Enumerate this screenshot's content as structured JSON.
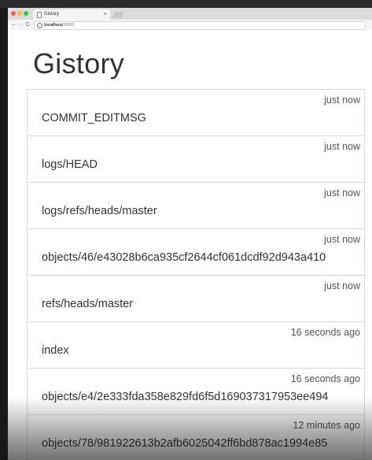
{
  "browser": {
    "tab_title": "Gistory",
    "tab_close": "×",
    "url_host": "localhost",
    "url_port": ":8808",
    "nav_back": "←",
    "nav_forward": "→",
    "nav_reload": "C",
    "info_icon": "i"
  },
  "page": {
    "title": "Gistory"
  },
  "files": [
    {
      "time": "just now",
      "path": "COMMIT_EDITMSG"
    },
    {
      "time": "just now",
      "path": "logs/HEAD"
    },
    {
      "time": "just now",
      "path": "logs/refs/heads/master"
    },
    {
      "time": "just now",
      "path": "objects/46/e43028b6ca935cf2644cf061dcdf92d943a410"
    },
    {
      "time": "just now",
      "path": "refs/heads/master"
    },
    {
      "time": "16 seconds ago",
      "path": "index"
    },
    {
      "time": "16 seconds ago",
      "path": "objects/e4/2e333fda358e829fd6f5d169037317953ee494"
    },
    {
      "time": "12 minutes ago",
      "path": "objects/78/981922613b2afb6025042ff6bd878ac1994e85"
    }
  ]
}
